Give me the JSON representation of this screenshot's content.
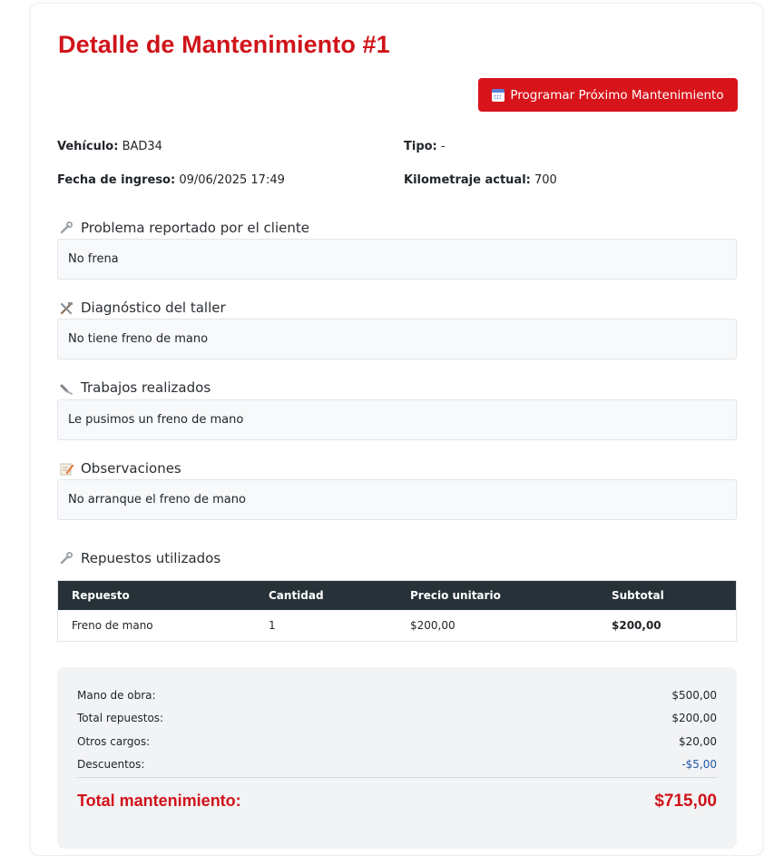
{
  "title": "Detalle de Mantenimiento #1",
  "schedule_button": "Programar Próximo Mantenimiento",
  "info": {
    "vehiculo_label": "Vehículo:",
    "vehiculo_value": "BAD34",
    "tipo_label": "Tipo:",
    "tipo_value": "-",
    "fecha_label": "Fecha de ingreso:",
    "fecha_value": "09/06/2025 17:49",
    "km_label": "Kilometraje actual:",
    "km_value": "700"
  },
  "sections": [
    {
      "heading": "Problema reportado por el cliente",
      "icon": "wrench-icon",
      "content": "No frena"
    },
    {
      "heading": "Diagnóstico del taller",
      "icon": "tools-icon",
      "content": "No tiene freno de mano"
    },
    {
      "heading": "Trabajos realizados",
      "icon": "screwdriver-icon",
      "content": "Le pusimos un freno de mano"
    },
    {
      "heading": "Observaciones",
      "icon": "memo-icon",
      "content": "No arranque el freno de mano"
    }
  ],
  "parts": {
    "heading": "Repuestos utilizados",
    "icon": "wrench-icon",
    "columns": [
      "Repuesto",
      "Cantidad",
      "Precio unitario",
      "Subtotal"
    ],
    "rows": [
      [
        "Freno de mano",
        "1",
        "$200,00",
        "$200,00"
      ]
    ]
  },
  "summary": {
    "mano_obra_label": "Mano de obra:",
    "mano_obra_value": "$500,00",
    "repuestos_label": "Total repuestos:",
    "repuestos_value": "$200,00",
    "otros_label": "Otros cargos:",
    "otros_value": "$20,00",
    "descuentos_label": "Descuentos:",
    "descuentos_value": "-$5,00",
    "total_label": "Total mantenimiento:",
    "total_value": "$715,00"
  },
  "colors": {
    "accent": "#d8141b",
    "table_header": "#263238",
    "discount": "#1e5aa8"
  }
}
